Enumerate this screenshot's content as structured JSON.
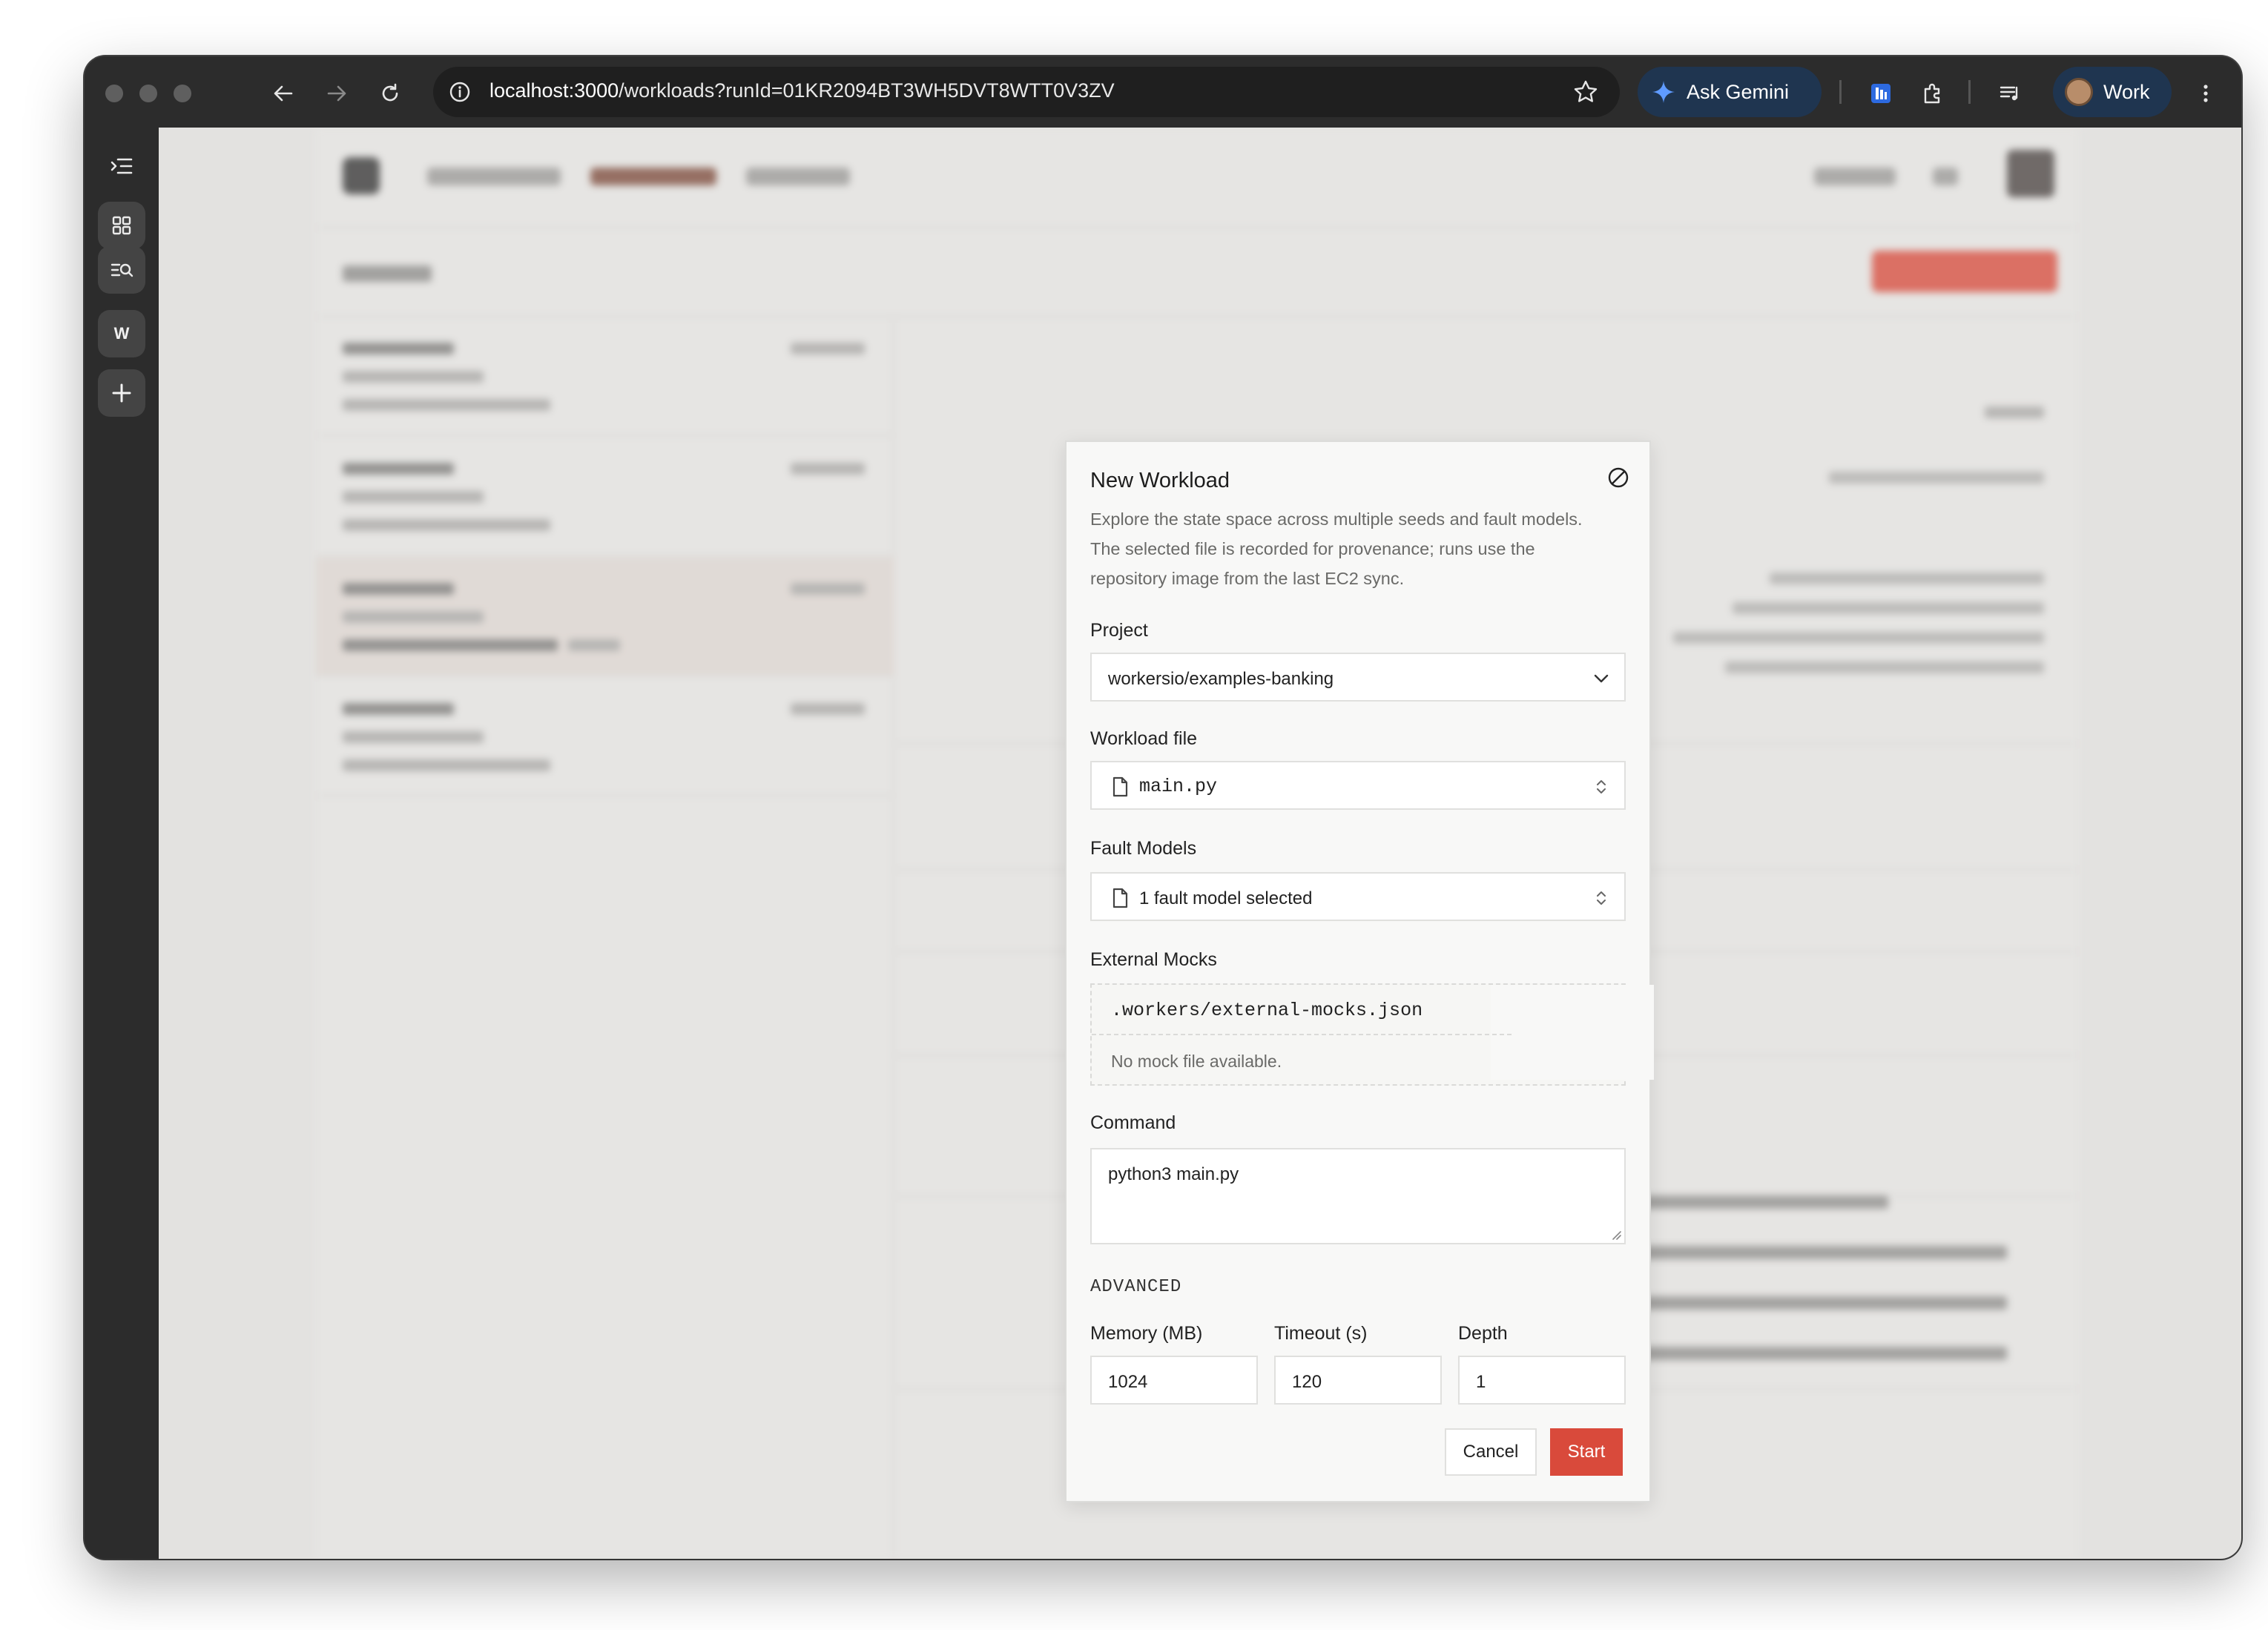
{
  "browser": {
    "url_host": "localhost:3000",
    "url_path": "/workloads?runId=01KR2094BT3WH5DVT8WTT0V3ZV",
    "gemini_label": "Ask Gemini",
    "profile_label": "Work"
  },
  "rail": {
    "workspace_initial": "W"
  },
  "modal": {
    "title": "New Workload",
    "description": "Explore the state space across multiple seeds and fault models. The selected file is recorded for provenance; runs use the repository image from the last EC2 sync.",
    "project": {
      "label": "Project",
      "value": "workersio/examples-banking"
    },
    "workload_file": {
      "label": "Workload file",
      "value": "main.py"
    },
    "fault_models": {
      "label": "Fault Models",
      "value": "1 fault model selected"
    },
    "external_mocks": {
      "label": "External Mocks",
      "path": ".workers/external-mocks.json",
      "note": "No mock file available."
    },
    "command": {
      "label": "Command",
      "value": "python3 main.py"
    },
    "advanced": {
      "heading": "ADVANCED",
      "memory_label": "Memory (MB)",
      "memory_value": "1024",
      "timeout_label": "Timeout (s)",
      "timeout_value": "120",
      "depth_label": "Depth",
      "depth_value": "1"
    },
    "cancel_label": "Cancel",
    "start_label": "Start"
  }
}
